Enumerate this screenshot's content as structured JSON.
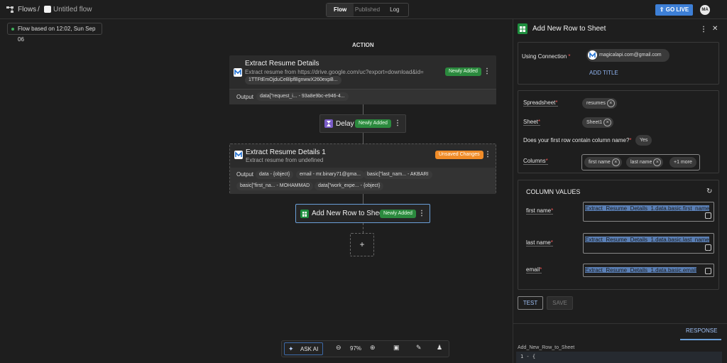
{
  "header": {
    "app_name": "Flows",
    "separator": "/",
    "flow_name": "Untitled flow",
    "tabs": [
      "Flow",
      "Published",
      "Log"
    ],
    "active_tab": "Flow",
    "go_live": "GO LIVE",
    "avatar_initials": "MA"
  },
  "canvas": {
    "flow_based_on": "Flow based on 12:02, Sun Sep 06",
    "action_label": "ACTION",
    "step1": {
      "title": "Extract Resume Details",
      "subtitle": "Extract resume from https://drive.google.com/uc?export=download&id=",
      "id_chip": "1TTFtEmOjduCeBlpfBgnwwX260expB...",
      "badge": "Newly Added",
      "output_label": "Output",
      "output_chips": [
        "data[\"request_i... - 93a8e9bc-e946-4..."
      ]
    },
    "delay": {
      "title": "Delay",
      "badge": "Newly Added"
    },
    "step2": {
      "title": "Extract Resume Details 1",
      "subtitle": "Extract resume from undefined",
      "badge": "Unsaved Changes",
      "output_label": "Output",
      "output_chips_row1": [
        "data - {object}",
        "email - mr.binary71@gma...",
        "basic[\"last_nam... - AKBARI"
      ],
      "output_chips_row2": [
        "basic[\"first_na... - MOHAMMAD",
        "data[\"work_expe... - {object}"
      ]
    },
    "step3": {
      "title": "Add New Row to Sheet",
      "badge": "Newly Added"
    },
    "add_step": "+"
  },
  "toolbar": {
    "ask_ai": "ASK AI",
    "zoom": "97%"
  },
  "panel": {
    "title": "Add New Row to Sheet",
    "connection_label": "Using Connection",
    "connection_value": "magicalapi.com@gmail.com",
    "add_title": "ADD TITLE",
    "spreadsheet_label": "Spreadsheet",
    "spreadsheet_value": "resumes",
    "sheet_label": "Sheet",
    "sheet_value": "Sheet1",
    "first_row_label": "Does your first row contain column name?",
    "first_row_value": "Yes",
    "columns_label": "Columns",
    "columns_values": [
      "first name",
      "last name"
    ],
    "columns_more": "+1 more",
    "column_values_title": "COLUMN VALUES",
    "fields": [
      {
        "label": "first name",
        "value": "Extract_Resume_Details_1.data.basic.first_name"
      },
      {
        "label": "last name",
        "value": "Extract_Resume_Details_1.data.basic.last_name"
      },
      {
        "label": "email",
        "value": "Extract_Resume_Details_1.data.basic.email"
      }
    ],
    "test_button": "TEST",
    "save_button": "SAVE",
    "response_tab": "RESPONSE",
    "response_name": "Add_New_Row_to_Sheet",
    "response_line": "1 - {"
  },
  "colors": {
    "accent": "#3d7fd6",
    "badge_new": "#2b8a3e",
    "badge_unsaved": "#f08c28",
    "sheets_green": "#1e8e3e"
  }
}
